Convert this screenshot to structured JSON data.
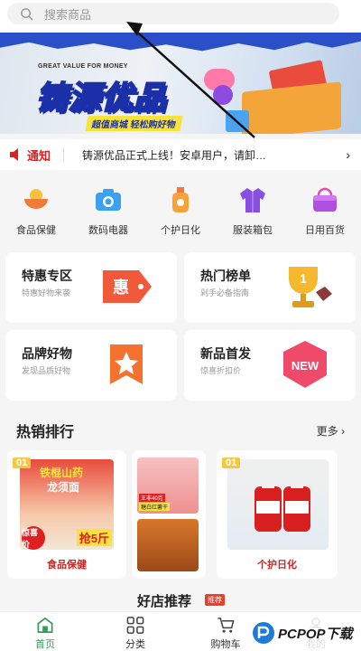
{
  "search": {
    "placeholder": "搜索商品"
  },
  "banner": {
    "subtitle_en": "GREAT VALUE FOR MONEY",
    "title": "铸源优品",
    "tagline": "超值商城 轻松购好物"
  },
  "notice": {
    "label": "通知",
    "text": "铸源优品正式上线！安卓用户，请卸…"
  },
  "categories": [
    {
      "label": "食品保健",
      "icon": "food-bowl-icon",
      "color": "#f6a23a"
    },
    {
      "label": "数码电器",
      "icon": "camera-icon",
      "color": "#3aa0f0"
    },
    {
      "label": "个护日化",
      "icon": "lotion-bottle-icon",
      "color": "#f07a3a"
    },
    {
      "label": "服装箱包",
      "icon": "jacket-icon",
      "color": "#8a4fe0"
    },
    {
      "label": "日用百货",
      "icon": "basket-icon",
      "color": "#b04fe0"
    }
  ],
  "promos": [
    {
      "title": "特惠专区",
      "subtitle": "特惠好物来袭",
      "icon": "discount-tag-icon",
      "icon_text": "惠"
    },
    {
      "title": "热门榜单",
      "subtitle": "剁手必备指南",
      "icon": "trophy-icon",
      "icon_text": "1"
    },
    {
      "title": "品牌好物",
      "subtitle": "发现品质好物",
      "icon": "star-badge-icon",
      "icon_text": ""
    },
    {
      "title": "新品首发",
      "subtitle": "惊喜折扣价",
      "icon": "new-badge-icon",
      "icon_text": "NEW"
    }
  ],
  "hot_sales": {
    "title": "热销排行",
    "more": "更多 ›",
    "cards": [
      {
        "rank": "01",
        "label": "食品保健",
        "img_text_1": "铁棍山药",
        "img_text_2": "龙须面",
        "price_tag": "抢5斤",
        "sticker": "惊喜价"
      },
      {
        "rank": "",
        "label": "",
        "img_text_1": "王非40克",
        "img_text_2": "糖白红薯干"
      },
      {
        "rank": "01",
        "label": "个护日化",
        "img_text_1": "",
        "img_text_2": ""
      }
    ]
  },
  "stores": {
    "title": "好店推荐",
    "badge": "推荐"
  },
  "tabbar": [
    {
      "label": "首页",
      "icon": "home-icon",
      "active": true
    },
    {
      "label": "分类",
      "icon": "grid-icon",
      "active": false
    },
    {
      "label": "购物车",
      "icon": "cart-icon",
      "active": false
    },
    {
      "label": "我的",
      "icon": "user-icon",
      "active": false
    }
  ],
  "watermark": {
    "text": "PCPOP下载"
  },
  "colors": {
    "accent_red": "#e02020",
    "brand_blue": "#1b2fa8",
    "active_green": "#3a9a5a"
  }
}
